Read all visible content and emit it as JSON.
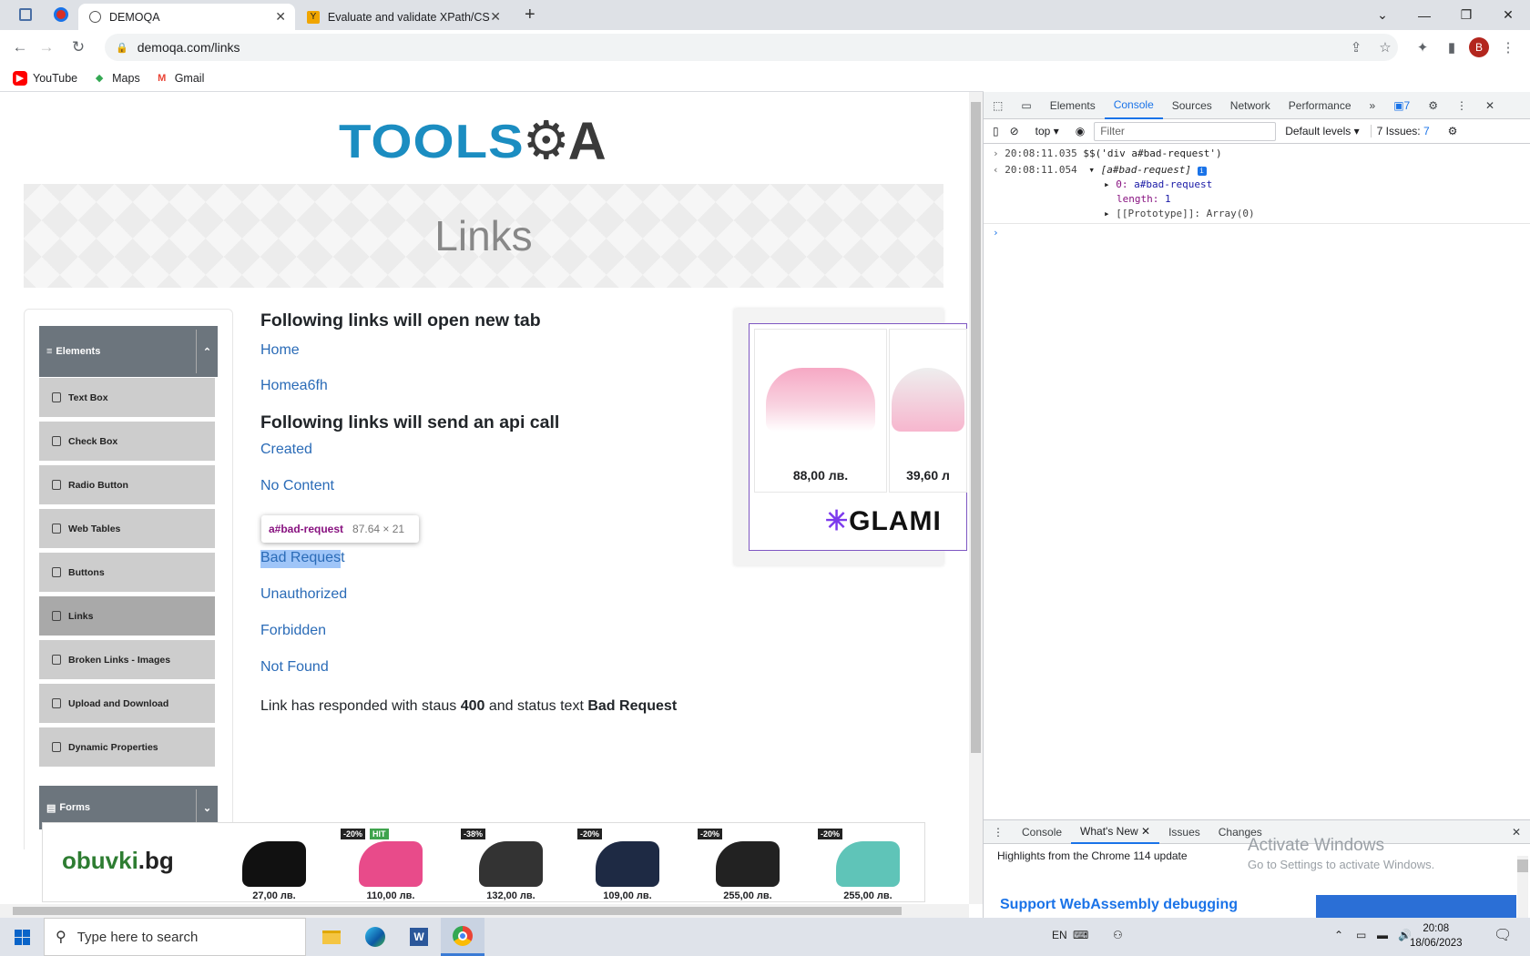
{
  "browser": {
    "tabs": [
      {
        "title": "DEMOQA",
        "active": true
      },
      {
        "title": "Evaluate and validate XPath/CSS",
        "active": false
      }
    ],
    "url": "demoqa.com/links",
    "avatar_letter": "B",
    "bookmarks": [
      {
        "label": "YouTube",
        "icon": "youtube-icon",
        "color": "#ff0000"
      },
      {
        "label": "Maps",
        "icon": "maps-icon",
        "color": "#34a853"
      },
      {
        "label": "Gmail",
        "icon": "gmail-icon",
        "color": "#ea4335"
      }
    ]
  },
  "page": {
    "logo": {
      "part1": "TOOLS",
      "part2": "A"
    },
    "banner_title": "Links",
    "sidebar": {
      "group_elements": "Elements",
      "items": [
        "Text Box",
        "Check Box",
        "Radio Button",
        "Web Tables",
        "Buttons",
        "Links",
        "Broken Links - Images",
        "Upload and Download",
        "Dynamic Properties"
      ],
      "selected": "Links",
      "group_forms": "Forms"
    },
    "heading_new_tab": "Following links will open new tab",
    "link_home": "Home",
    "link_dynamic_home": "Homea6fh",
    "heading_api": "Following links will send an api call",
    "links_api": [
      "Created",
      "No Content",
      "Bad Request",
      "Unauthorized",
      "Forbidden",
      "Not Found"
    ],
    "inspect_tooltip": {
      "selector": "a#bad-request",
      "size": "87.64 × 21"
    },
    "response": {
      "prefix": "Link has responded with staus ",
      "code": "400",
      "middle": " and status text ",
      "text": "Bad Request"
    },
    "glami_ad": {
      "prices": [
        "88,00 лв.",
        "39,60 л"
      ],
      "brand": "GLAMI"
    },
    "bottom_ad": {
      "brand_a": "obuvki",
      "brand_b": ".bg",
      "products": [
        {
          "price": "27,00 лв.",
          "badge": ""
        },
        {
          "price": "110,00 лв.",
          "badge": "-20%",
          "hit": "HIT"
        },
        {
          "price": "132,00 лв.",
          "badge": "-38%"
        },
        {
          "price": "109,00 лв.",
          "badge": "-20%"
        },
        {
          "price": "255,00 лв.",
          "badge": "-20%"
        },
        {
          "price": "255,00 лв.",
          "badge": "-20%"
        }
      ]
    }
  },
  "devtools": {
    "tabs": [
      "Elements",
      "Console",
      "Sources",
      "Network",
      "Performance"
    ],
    "active_tab": "Console",
    "messages_badge": "7",
    "context": "top",
    "filter_placeholder": "Filter",
    "levels": "Default levels",
    "issues": "7 Issues:",
    "issues_count": "7",
    "console": {
      "input_time": "20:08:11.035",
      "input_cmd": "$$('div a#bad-request')",
      "output_time": "20:08:11.054",
      "output_summary": "[a#bad-request]",
      "entry0_key": "0:",
      "entry0_val": "a#bad-request",
      "length_key": "length:",
      "length_val": "1",
      "proto": "[[Prototype]]: Array(0)"
    },
    "drawer_tabs": [
      "Console",
      "What's New",
      "Issues",
      "Changes"
    ],
    "drawer_active": "What's New",
    "whats_new_header": "Highlights from the Chrome 114 update",
    "whats_new_item": "Support WebAssembly debugging",
    "activate_line1": "Activate Windows",
    "activate_line2": "Go to Settings to activate Windows."
  },
  "taskbar": {
    "search_placeholder": "Type here to search",
    "lang": "EN",
    "time": "20:08",
    "date": "18/06/2023"
  }
}
